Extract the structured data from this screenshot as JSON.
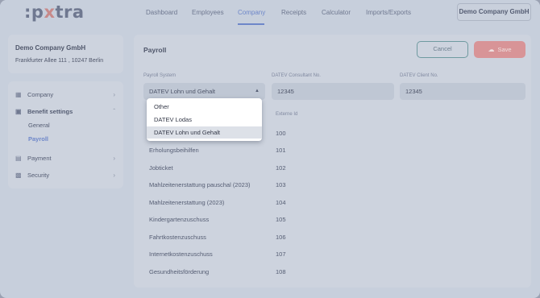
{
  "brand": {
    "logo_prefix": ":p",
    "logo_x": "x",
    "logo_suffix": "tra"
  },
  "nav": {
    "items": [
      {
        "label": "Dashboard"
      },
      {
        "label": "Employees"
      },
      {
        "label": "Company",
        "active": true
      },
      {
        "label": "Receipts"
      },
      {
        "label": "Calculator"
      },
      {
        "label": "Imports/Exports"
      }
    ],
    "company_button": "Demo Company GmbH"
  },
  "company_card": {
    "name": "Demo Company GmbH",
    "address": "Frankfurter Allee 111 , 10247 Berlin"
  },
  "sidebar": {
    "items": [
      {
        "label": "Company",
        "icon": "building-icon"
      },
      {
        "label": "Benefit settings",
        "icon": "gift-icon",
        "expanded": true,
        "children": [
          {
            "label": "General"
          },
          {
            "label": "Payroll",
            "active": true
          }
        ]
      },
      {
        "label": "Payment",
        "icon": "document-icon"
      },
      {
        "label": "Security",
        "icon": "lock-icon"
      }
    ]
  },
  "main": {
    "title": "Payroll",
    "cancel_label": "Cancel",
    "save_label": "Save",
    "payroll_system": {
      "label": "Payroll System",
      "value": "DATEV Lohn und Gehalt"
    },
    "consultant_no": {
      "label": "DATEV Consultant No.",
      "value": "12345"
    },
    "client_no": {
      "label": "DATEV Client No.",
      "value": "12345"
    },
    "external_id_header": "Externe Id",
    "rows": [
      {
        "label": "Erholungsbeihilfen",
        "value": "101"
      },
      {
        "label": "Jobticket",
        "value": "102"
      },
      {
        "label": "Mahlzeitenerstattung pauschal (2023)",
        "value": "103"
      },
      {
        "label": "Mahlzeitenerstattung (2023)",
        "value": "104"
      },
      {
        "label": "Kindergartenzuschuss",
        "value": "105"
      },
      {
        "label": "Fahrtkostenzuschuss",
        "value": "106"
      },
      {
        "label": "Internetkostenzuschuss",
        "value": "107"
      },
      {
        "label": "Gesundheitsförderung",
        "value": "108"
      }
    ],
    "first_row_value": "100"
  },
  "dropdown": {
    "options": [
      "Other",
      "DATEV Lodas",
      "DATEV Lohn und Gehalt"
    ],
    "selected": "DATEV Lohn und Gehalt"
  },
  "colors": {
    "accent": "#6e87c9",
    "save": "#d89497",
    "background": "#c7cfdc"
  }
}
